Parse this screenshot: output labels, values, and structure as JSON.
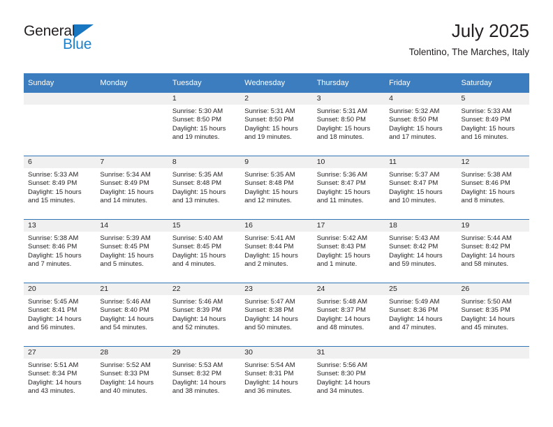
{
  "brand": {
    "name_part1": "General",
    "name_part2": "Blue",
    "accent_color": "#1b81cd",
    "triangle_color": "#1976c0"
  },
  "header": {
    "title": "July 2025",
    "subtitle": "Tolentino, The Marches, Italy"
  },
  "calendar": {
    "header_bg": "#3b7dbf",
    "daynum_bg": "#f0f0f0",
    "weekday_headers": [
      "Sunday",
      "Monday",
      "Tuesday",
      "Wednesday",
      "Thursday",
      "Friday",
      "Saturday"
    ],
    "labels": {
      "sunrise": "Sunrise:",
      "sunset": "Sunset:",
      "daylight": "Daylight:"
    },
    "weeks": [
      [
        {
          "day": "",
          "sunrise": "",
          "sunset": "",
          "daylight_line1": "",
          "daylight_line2": ""
        },
        {
          "day": "",
          "sunrise": "",
          "sunset": "",
          "daylight_line1": "",
          "daylight_line2": ""
        },
        {
          "day": "1",
          "sunrise": "Sunrise: 5:30 AM",
          "sunset": "Sunset: 8:50 PM",
          "daylight_line1": "Daylight: 15 hours",
          "daylight_line2": "and 19 minutes."
        },
        {
          "day": "2",
          "sunrise": "Sunrise: 5:31 AM",
          "sunset": "Sunset: 8:50 PM",
          "daylight_line1": "Daylight: 15 hours",
          "daylight_line2": "and 19 minutes."
        },
        {
          "day": "3",
          "sunrise": "Sunrise: 5:31 AM",
          "sunset": "Sunset: 8:50 PM",
          "daylight_line1": "Daylight: 15 hours",
          "daylight_line2": "and 18 minutes."
        },
        {
          "day": "4",
          "sunrise": "Sunrise: 5:32 AM",
          "sunset": "Sunset: 8:50 PM",
          "daylight_line1": "Daylight: 15 hours",
          "daylight_line2": "and 17 minutes."
        },
        {
          "day": "5",
          "sunrise": "Sunrise: 5:33 AM",
          "sunset": "Sunset: 8:49 PM",
          "daylight_line1": "Daylight: 15 hours",
          "daylight_line2": "and 16 minutes."
        }
      ],
      [
        {
          "day": "6",
          "sunrise": "Sunrise: 5:33 AM",
          "sunset": "Sunset: 8:49 PM",
          "daylight_line1": "Daylight: 15 hours",
          "daylight_line2": "and 15 minutes."
        },
        {
          "day": "7",
          "sunrise": "Sunrise: 5:34 AM",
          "sunset": "Sunset: 8:49 PM",
          "daylight_line1": "Daylight: 15 hours",
          "daylight_line2": "and 14 minutes."
        },
        {
          "day": "8",
          "sunrise": "Sunrise: 5:35 AM",
          "sunset": "Sunset: 8:48 PM",
          "daylight_line1": "Daylight: 15 hours",
          "daylight_line2": "and 13 minutes."
        },
        {
          "day": "9",
          "sunrise": "Sunrise: 5:35 AM",
          "sunset": "Sunset: 8:48 PM",
          "daylight_line1": "Daylight: 15 hours",
          "daylight_line2": "and 12 minutes."
        },
        {
          "day": "10",
          "sunrise": "Sunrise: 5:36 AM",
          "sunset": "Sunset: 8:47 PM",
          "daylight_line1": "Daylight: 15 hours",
          "daylight_line2": "and 11 minutes."
        },
        {
          "day": "11",
          "sunrise": "Sunrise: 5:37 AM",
          "sunset": "Sunset: 8:47 PM",
          "daylight_line1": "Daylight: 15 hours",
          "daylight_line2": "and 10 minutes."
        },
        {
          "day": "12",
          "sunrise": "Sunrise: 5:38 AM",
          "sunset": "Sunset: 8:46 PM",
          "daylight_line1": "Daylight: 15 hours",
          "daylight_line2": "and 8 minutes."
        }
      ],
      [
        {
          "day": "13",
          "sunrise": "Sunrise: 5:38 AM",
          "sunset": "Sunset: 8:46 PM",
          "daylight_line1": "Daylight: 15 hours",
          "daylight_line2": "and 7 minutes."
        },
        {
          "day": "14",
          "sunrise": "Sunrise: 5:39 AM",
          "sunset": "Sunset: 8:45 PM",
          "daylight_line1": "Daylight: 15 hours",
          "daylight_line2": "and 5 minutes."
        },
        {
          "day": "15",
          "sunrise": "Sunrise: 5:40 AM",
          "sunset": "Sunset: 8:45 PM",
          "daylight_line1": "Daylight: 15 hours",
          "daylight_line2": "and 4 minutes."
        },
        {
          "day": "16",
          "sunrise": "Sunrise: 5:41 AM",
          "sunset": "Sunset: 8:44 PM",
          "daylight_line1": "Daylight: 15 hours",
          "daylight_line2": "and 2 minutes."
        },
        {
          "day": "17",
          "sunrise": "Sunrise: 5:42 AM",
          "sunset": "Sunset: 8:43 PM",
          "daylight_line1": "Daylight: 15 hours",
          "daylight_line2": "and 1 minute."
        },
        {
          "day": "18",
          "sunrise": "Sunrise: 5:43 AM",
          "sunset": "Sunset: 8:42 PM",
          "daylight_line1": "Daylight: 14 hours",
          "daylight_line2": "and 59 minutes."
        },
        {
          "day": "19",
          "sunrise": "Sunrise: 5:44 AM",
          "sunset": "Sunset: 8:42 PM",
          "daylight_line1": "Daylight: 14 hours",
          "daylight_line2": "and 58 minutes."
        }
      ],
      [
        {
          "day": "20",
          "sunrise": "Sunrise: 5:45 AM",
          "sunset": "Sunset: 8:41 PM",
          "daylight_line1": "Daylight: 14 hours",
          "daylight_line2": "and 56 minutes."
        },
        {
          "day": "21",
          "sunrise": "Sunrise: 5:46 AM",
          "sunset": "Sunset: 8:40 PM",
          "daylight_line1": "Daylight: 14 hours",
          "daylight_line2": "and 54 minutes."
        },
        {
          "day": "22",
          "sunrise": "Sunrise: 5:46 AM",
          "sunset": "Sunset: 8:39 PM",
          "daylight_line1": "Daylight: 14 hours",
          "daylight_line2": "and 52 minutes."
        },
        {
          "day": "23",
          "sunrise": "Sunrise: 5:47 AM",
          "sunset": "Sunset: 8:38 PM",
          "daylight_line1": "Daylight: 14 hours",
          "daylight_line2": "and 50 minutes."
        },
        {
          "day": "24",
          "sunrise": "Sunrise: 5:48 AM",
          "sunset": "Sunset: 8:37 PM",
          "daylight_line1": "Daylight: 14 hours",
          "daylight_line2": "and 48 minutes."
        },
        {
          "day": "25",
          "sunrise": "Sunrise: 5:49 AM",
          "sunset": "Sunset: 8:36 PM",
          "daylight_line1": "Daylight: 14 hours",
          "daylight_line2": "and 47 minutes."
        },
        {
          "day": "26",
          "sunrise": "Sunrise: 5:50 AM",
          "sunset": "Sunset: 8:35 PM",
          "daylight_line1": "Daylight: 14 hours",
          "daylight_line2": "and 45 minutes."
        }
      ],
      [
        {
          "day": "27",
          "sunrise": "Sunrise: 5:51 AM",
          "sunset": "Sunset: 8:34 PM",
          "daylight_line1": "Daylight: 14 hours",
          "daylight_line2": "and 43 minutes."
        },
        {
          "day": "28",
          "sunrise": "Sunrise: 5:52 AM",
          "sunset": "Sunset: 8:33 PM",
          "daylight_line1": "Daylight: 14 hours",
          "daylight_line2": "and 40 minutes."
        },
        {
          "day": "29",
          "sunrise": "Sunrise: 5:53 AM",
          "sunset": "Sunset: 8:32 PM",
          "daylight_line1": "Daylight: 14 hours",
          "daylight_line2": "and 38 minutes."
        },
        {
          "day": "30",
          "sunrise": "Sunrise: 5:54 AM",
          "sunset": "Sunset: 8:31 PM",
          "daylight_line1": "Daylight: 14 hours",
          "daylight_line2": "and 36 minutes."
        },
        {
          "day": "31",
          "sunrise": "Sunrise: 5:56 AM",
          "sunset": "Sunset: 8:30 PM",
          "daylight_line1": "Daylight: 14 hours",
          "daylight_line2": "and 34 minutes."
        },
        {
          "day": "",
          "sunrise": "",
          "sunset": "",
          "daylight_line1": "",
          "daylight_line2": ""
        },
        {
          "day": "",
          "sunrise": "",
          "sunset": "",
          "daylight_line1": "",
          "daylight_line2": ""
        }
      ]
    ]
  }
}
